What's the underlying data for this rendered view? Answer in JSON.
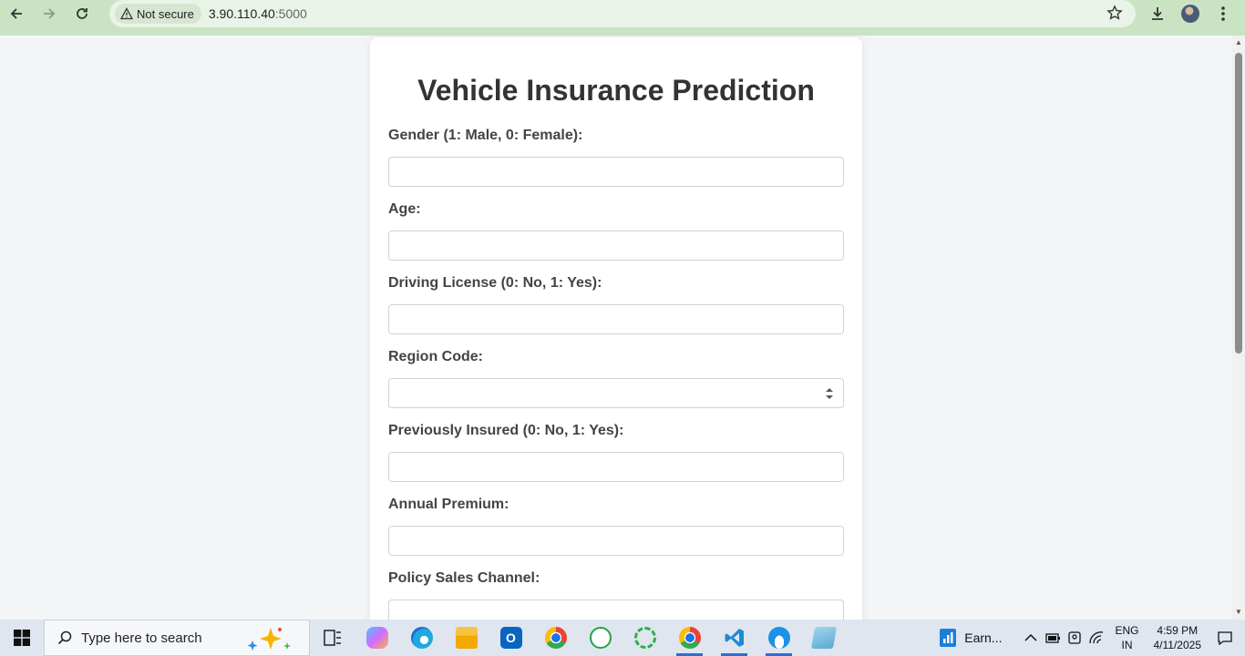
{
  "browser": {
    "security_label": "Not secure",
    "url_host": "3.90.110.40",
    "url_port": ":5000"
  },
  "form": {
    "title": "Vehicle Insurance Prediction",
    "fields": [
      {
        "label": "Gender (1: Male, 0: Female):",
        "value": ""
      },
      {
        "label": "Age:",
        "value": ""
      },
      {
        "label": "Driving License (0: No, 1: Yes):",
        "value": ""
      },
      {
        "label": "Region Code:",
        "value": ""
      },
      {
        "label": "Previously Insured (0: No, 1: Yes):",
        "value": ""
      },
      {
        "label": "Annual Premium:",
        "value": ""
      },
      {
        "label": "Policy Sales Channel:",
        "value": ""
      }
    ]
  },
  "taskbar": {
    "search_placeholder": "Type here to search",
    "widget_label": "Earn...",
    "lang_line1": "ENG",
    "lang_line2": "IN",
    "time": "4:59 PM",
    "date": "4/11/2025",
    "apps": [
      "task-view",
      "copilot",
      "edge",
      "file-explorer",
      "outlook",
      "chrome",
      "whatsapp",
      "progress-app",
      "chrome-profile",
      "vscode",
      "docker",
      "notepad"
    ]
  },
  "colors": {
    "toolbar_bg": "#c9e3c3",
    "page_bg": "#f4f5f7",
    "title_color": "#333333",
    "label_color": "#444444"
  }
}
